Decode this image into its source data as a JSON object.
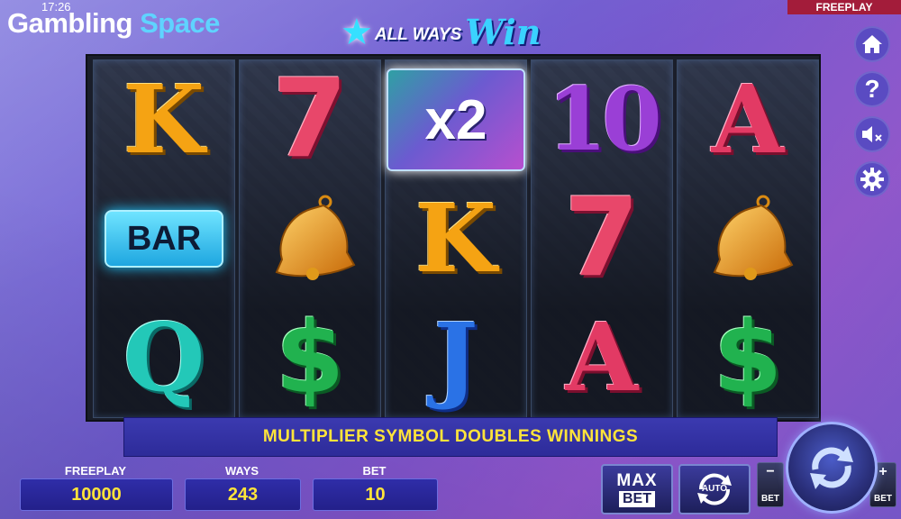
{
  "status": {
    "clock": "17:26",
    "mode_tag": "FREEPLAY"
  },
  "brand": {
    "part1": "Gambling",
    "part2": "Space"
  },
  "game_logo": {
    "part1": "ALL WAYS",
    "part2": "Win"
  },
  "side_menu": [
    {
      "name": "home",
      "icon": "home-icon"
    },
    {
      "name": "help",
      "icon": "help-icon"
    },
    {
      "name": "sound",
      "icon": "sound-muted-icon"
    },
    {
      "name": "settings",
      "icon": "gear-icon"
    }
  ],
  "reels": [
    [
      "K",
      "BAR",
      "Q"
    ],
    [
      "7",
      "bell",
      "$"
    ],
    [
      "x2",
      "K",
      "J"
    ],
    [
      "10",
      "7",
      "A"
    ],
    [
      "A",
      "bell",
      "$"
    ]
  ],
  "message": "MULTIPLIER SYMBOL DOUBLES WINNINGS",
  "stats": {
    "freeplay_label": "FREEPLAY",
    "freeplay_value": "10000",
    "ways_label": "WAYS",
    "ways_value": "243",
    "bet_label": "BET",
    "bet_value": "10"
  },
  "controls": {
    "max_label": "MAX",
    "max_bet_label": "BET",
    "auto_label": "AUTO",
    "bet_minus_sign": "−",
    "bet_minus_label": "BET",
    "bet_plus_sign": "+",
    "bet_plus_label": "BET"
  },
  "colors": {
    "accent": "#ffe43a",
    "tag": "#a31c3a",
    "panel": "#2f2da8"
  }
}
